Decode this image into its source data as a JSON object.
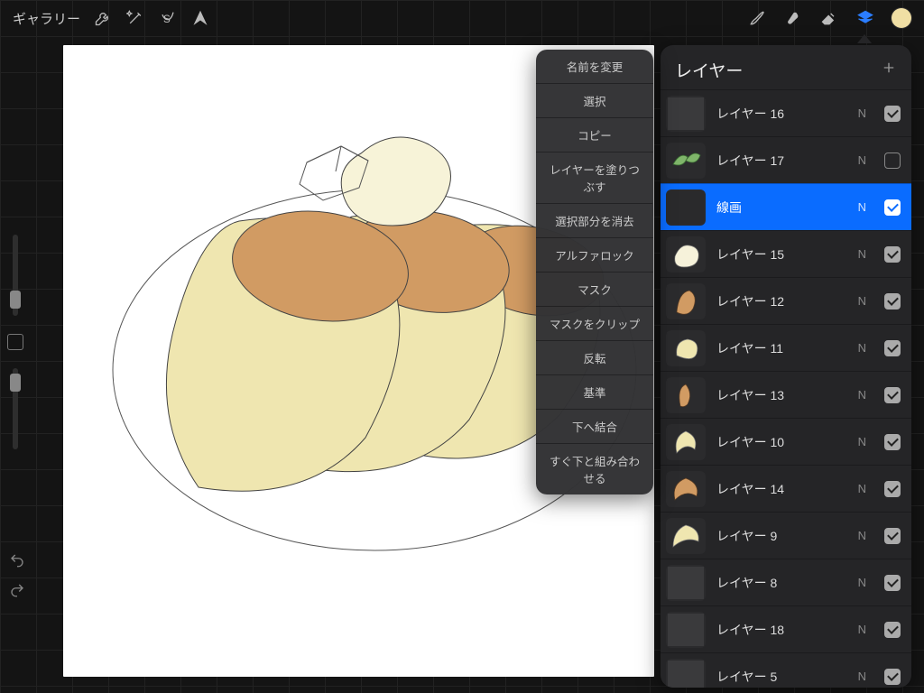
{
  "topbar": {
    "gallery_label": "ギャラリー"
  },
  "layers_panel": {
    "title": "レイヤー",
    "items": [
      {
        "name": "レイヤー 16",
        "blend": "N",
        "visible": true,
        "selected": false,
        "thumb": "gray"
      },
      {
        "name": "レイヤー 17",
        "blend": "N",
        "visible": false,
        "selected": false,
        "thumb": "leaves"
      },
      {
        "name": "線画",
        "blend": "N",
        "visible": true,
        "selected": true,
        "thumb": "dark"
      },
      {
        "name": "レイヤー 15",
        "blend": "N",
        "visible": true,
        "selected": false,
        "thumb": "cream"
      },
      {
        "name": "レイヤー 12",
        "blend": "N",
        "visible": true,
        "selected": false,
        "thumb": "tan-slice"
      },
      {
        "name": "レイヤー 11",
        "blend": "N",
        "visible": true,
        "selected": false,
        "thumb": "pale-blob"
      },
      {
        "name": "レイヤー 13",
        "blend": "N",
        "visible": true,
        "selected": false,
        "thumb": "tan-wedge"
      },
      {
        "name": "レイヤー 10",
        "blend": "N",
        "visible": true,
        "selected": false,
        "thumb": "pale-crescent"
      },
      {
        "name": "レイヤー 14",
        "blend": "N",
        "visible": true,
        "selected": false,
        "thumb": "tan-crescent"
      },
      {
        "name": "レイヤー 9",
        "blend": "N",
        "visible": true,
        "selected": false,
        "thumb": "cream-crescent"
      },
      {
        "name": "レイヤー 8",
        "blend": "N",
        "visible": true,
        "selected": false,
        "thumb": "gray"
      },
      {
        "name": "レイヤー 18",
        "blend": "N",
        "visible": true,
        "selected": false,
        "thumb": "gray"
      },
      {
        "name": "レイヤー 5",
        "blend": "N",
        "visible": true,
        "selected": false,
        "thumb": "gray"
      }
    ]
  },
  "context_menu": {
    "items": [
      "名前を変更",
      "選択",
      "コピー",
      "レイヤーを塗りつぶす",
      "選択部分を消去",
      "アルファロック",
      "マスク",
      "マスクをクリップ",
      "反転",
      "基準",
      "下へ結合",
      "すぐ下と組み合わせる"
    ]
  },
  "colors": {
    "accent": "#0a6cff",
    "swatch": "#f0dfa4"
  }
}
